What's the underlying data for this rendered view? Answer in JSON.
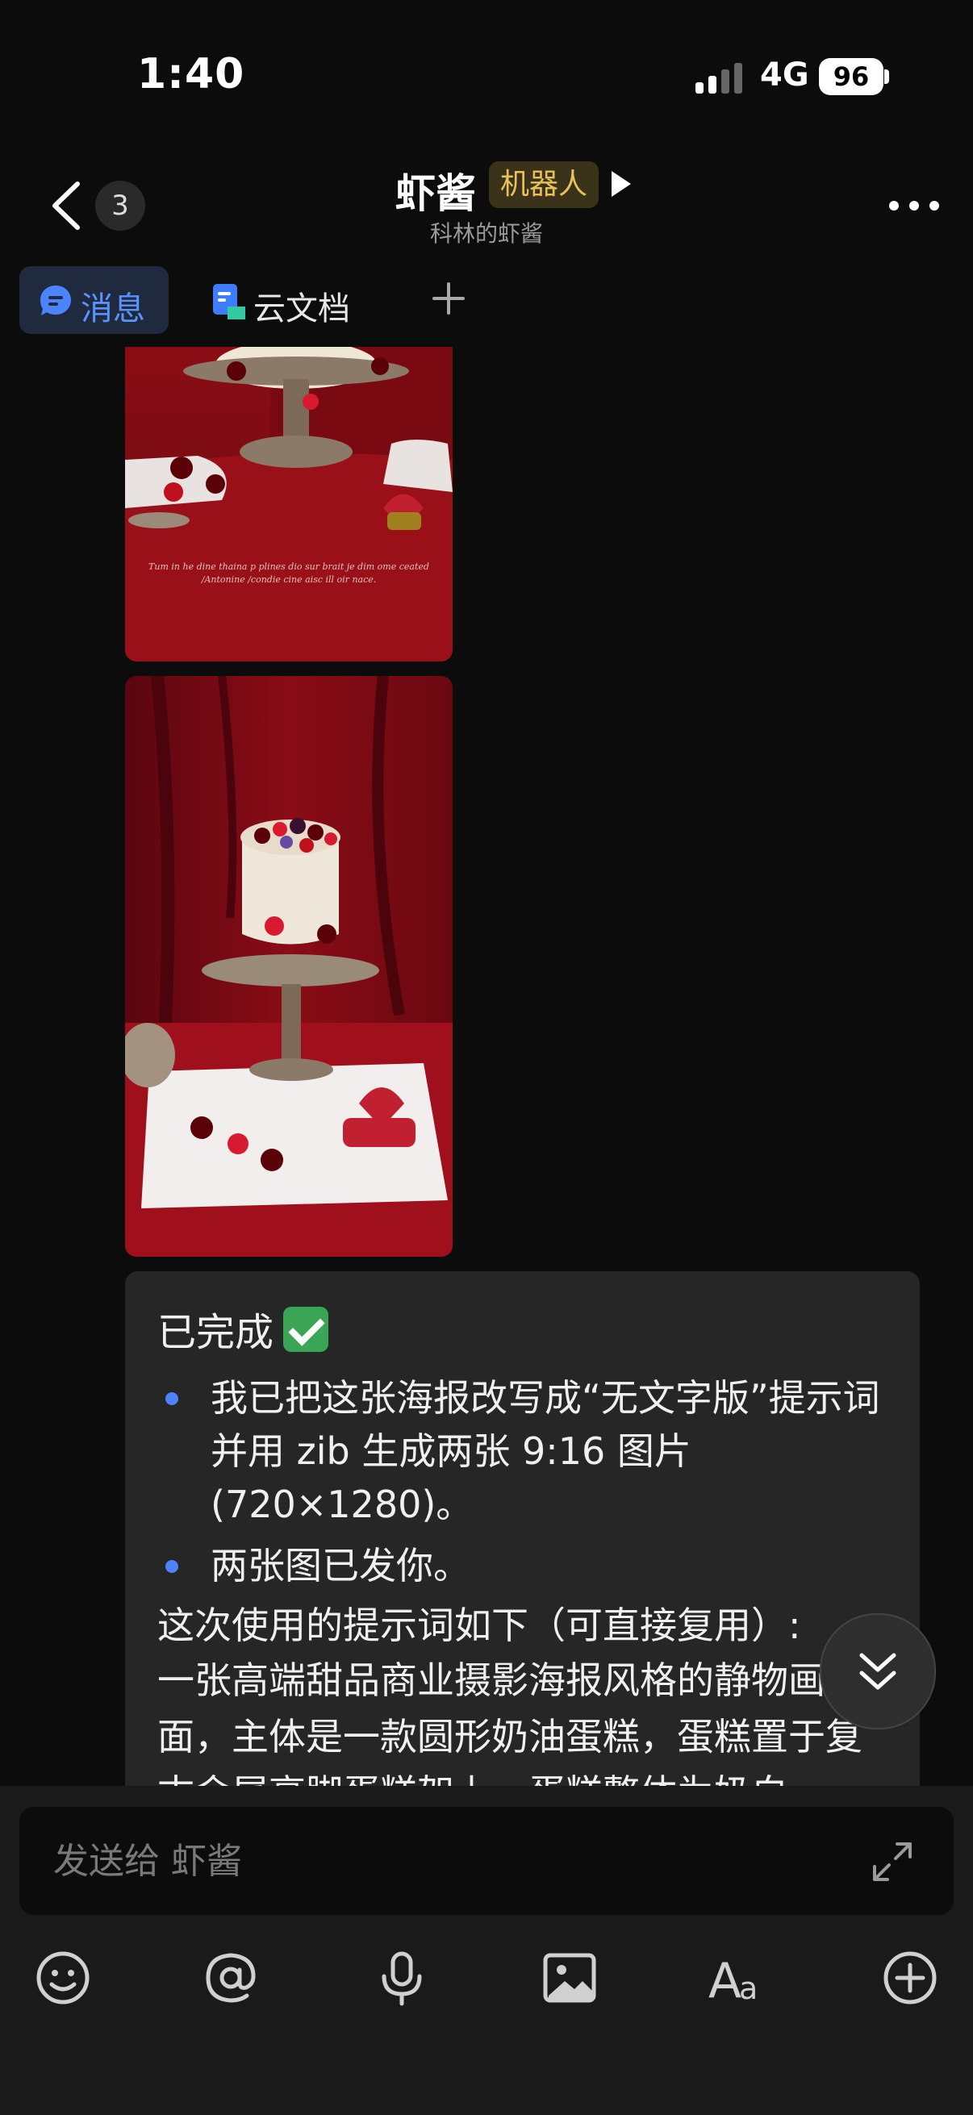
{
  "status_bar": {
    "time": "1:40",
    "network": "4G",
    "battery": "96"
  },
  "nav": {
    "unread_count": "3",
    "title": "虾酱",
    "robot_tag": "机器人",
    "subtitle": "科林的虾酱"
  },
  "tabs": [
    {
      "label": "消息",
      "active": true
    },
    {
      "label": "云文档",
      "active": false
    }
  ],
  "message": {
    "heading": "已完成",
    "bullets": [
      "我已把这张海报改写成“无文字版”提示词并用 zib 生成两张 9:16 图片 (720×1280)。",
      "两张图已发你。"
    ],
    "para1": "这次使用的提示词如下（可直接复用）:",
    "para2": "一张高端甜品商业摄影海报风格的静物画面，主体是一款圆形奶油蛋糕，蛋糕置于复古金属高脚蛋糕架上，蛋糕整体为奶白"
  },
  "composer": {
    "placeholder": "发送给 虾酱"
  },
  "colors": {
    "accent": "#4c84ff",
    "tag_text": "#e8c15a",
    "bubble": "#262626"
  }
}
